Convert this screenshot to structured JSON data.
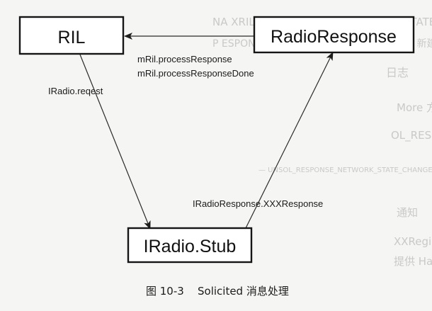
{
  "background_text": {
    "lines": [
      "NA XRIL_UNSOL_RESPONSE_RADIO_STATE_CHANGE",
      "P   ESPONSE_NETWORK_STATE_CHANGED 新建参数",
      "日志",
      "More 方法记录 UnSolicited RIL 日志，主要 UNSOL 消息",
      "OL_RESPONSE_NETWORK_STATE_CHANGED 日志",
      "— UNSOL_RESPONSE_NETWORK_STATE_CHANGED",
      "通知",
      "XXRegistrants 和 mXXXRegistrant 对象列表消息",
      "提供 Handler 对象在 handleMessage 方法中接收 Messa"
    ]
  },
  "nodes": {
    "ril": {
      "label": "RIL"
    },
    "radio_response": {
      "label": "RadioResponse"
    },
    "radio_stub": {
      "label": "IRadio.Stub"
    }
  },
  "edges": {
    "response_to_ril": {
      "labels": [
        "mRil.processResponse",
        "mRil.processResponseDone"
      ]
    },
    "ril_to_stub": {
      "label": "IRadio.reqest"
    },
    "stub_to_response": {
      "label": "IRadioResponse.XXXResponse"
    }
  },
  "caption": {
    "figure": "图 10-3",
    "title": "Solicited 消息处理"
  }
}
